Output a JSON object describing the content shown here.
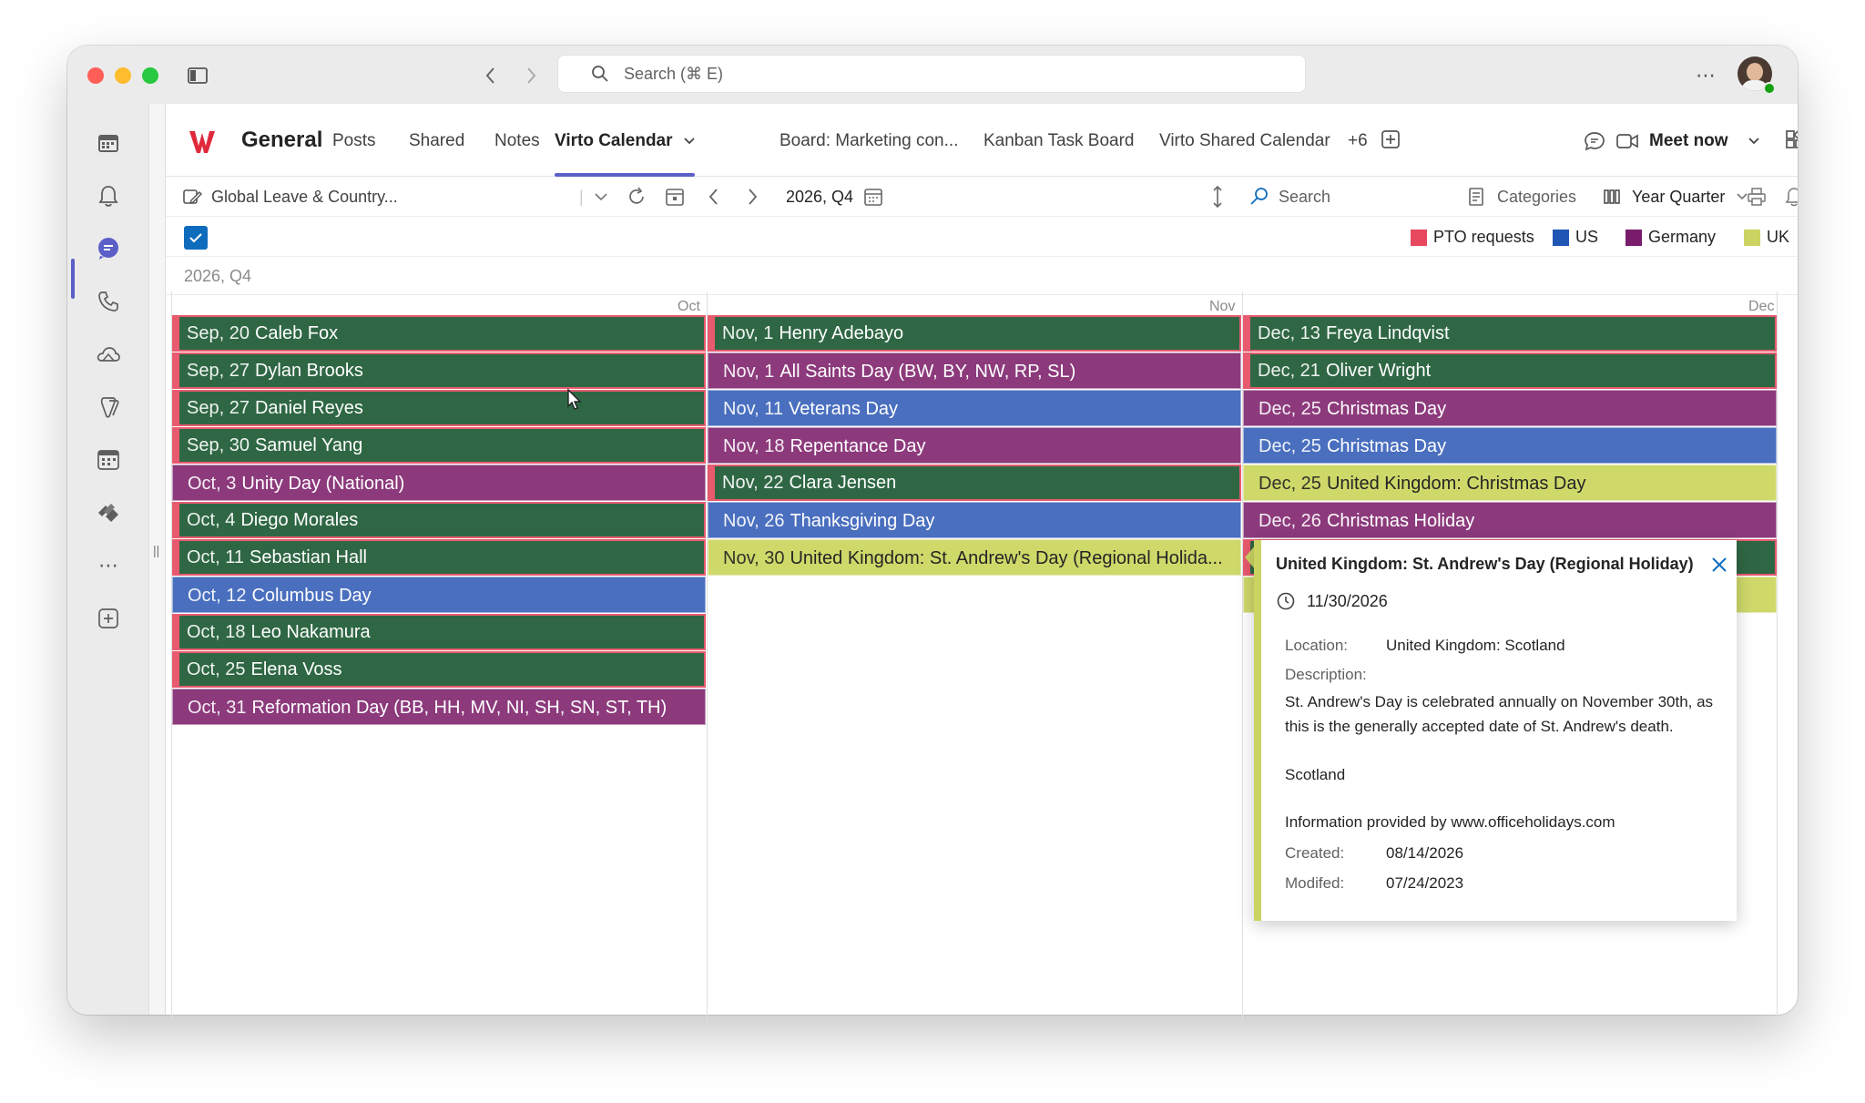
{
  "titlebar": {
    "search_placeholder": "Search (⌘ E)"
  },
  "channel": {
    "title": "General",
    "tabs": [
      {
        "label": "Posts"
      },
      {
        "label": "Shared"
      },
      {
        "label": "Notes"
      },
      {
        "label": "Virto Calendar"
      },
      {
        "label": "Board: Marketing con..."
      },
      {
        "label": "Kanban Task Board"
      },
      {
        "label": "Virto Shared Calendar"
      },
      {
        "label": "+6"
      }
    ],
    "meet_now": "Meet now"
  },
  "toolbar": {
    "calendar_name": "Global Leave & Country...",
    "period": "2026, Q4",
    "search_placeholder": "Search",
    "categories": "Categories",
    "view": "Year Quarter"
  },
  "legend": [
    {
      "label": "PTO requests",
      "color": "#e8485e"
    },
    {
      "label": "US",
      "color": "#1f55b5"
    },
    {
      "label": "Germany",
      "color": "#7a1c6c"
    },
    {
      "label": "UK",
      "color": "#cbd462"
    }
  ],
  "period_header": "2026, Q4",
  "months": [
    "Oct",
    "Nov",
    "Dec"
  ],
  "colors": {
    "pto": "#2f6744",
    "us": "#4a6fbf",
    "germany": "#8c3a7c",
    "uk": "#cfd96a",
    "pto_border": "#e85a6e",
    "accent": "#5b5fc7"
  },
  "columns": [
    {
      "events": [
        {
          "date": "Sep, 20",
          "title": "Caleb Fox",
          "type": "pto"
        },
        {
          "date": "Sep, 27",
          "title": "Dylan Brooks",
          "type": "pto"
        },
        {
          "date": "Sep, 27",
          "title": "Daniel Reyes",
          "type": "pto"
        },
        {
          "date": "Sep, 30",
          "title": "Samuel Yang",
          "type": "pto"
        },
        {
          "date": "Oct, 3",
          "title": "Unity Day (National)",
          "type": "germany"
        },
        {
          "date": "Oct, 4",
          "title": "Diego Morales",
          "type": "pto"
        },
        {
          "date": "Oct, 11",
          "title": "Sebastian Hall",
          "type": "pto"
        },
        {
          "date": "Oct, 12",
          "title": "Columbus Day",
          "type": "us"
        },
        {
          "date": "Oct, 18",
          "title": "Leo Nakamura",
          "type": "pto"
        },
        {
          "date": "Oct, 25",
          "title": "Elena Voss",
          "type": "pto"
        },
        {
          "date": "Oct, 31",
          "title": "Reformation Day (BB, HH, MV, NI, SH, SN, ST, TH)",
          "type": "germany"
        }
      ]
    },
    {
      "events": [
        {
          "date": "Nov, 1",
          "title": "Henry Adebayo",
          "type": "pto"
        },
        {
          "date": "Nov, 1",
          "title": "All Saints Day (BW, BY, NW, RP, SL)",
          "type": "germany"
        },
        {
          "date": "Nov, 11",
          "title": "Veterans Day",
          "type": "us"
        },
        {
          "date": "Nov, 18",
          "title": "Repentance Day",
          "type": "germany"
        },
        {
          "date": "Nov, 22",
          "title": "Clara Jensen",
          "type": "pto"
        },
        {
          "date": "Nov, 26",
          "title": "Thanksgiving Day",
          "type": "us"
        },
        {
          "date": "Nov, 30",
          "title": "United Kingdom: St. Andrew's Day (Regional Holida...",
          "type": "uk"
        }
      ]
    },
    {
      "events": [
        {
          "date": "Dec, 13",
          "title": "Freya Lindqvist",
          "type": "pto"
        },
        {
          "date": "Dec, 21",
          "title": "Oliver Wright",
          "type": "pto"
        },
        {
          "date": "Dec, 25",
          "title": "Christmas Day",
          "type": "germany"
        },
        {
          "date": "Dec, 25",
          "title": "Christmas Day",
          "type": "us"
        },
        {
          "date": "Dec, 25",
          "title": "United Kingdom: Christmas Day",
          "type": "uk"
        },
        {
          "date": "Dec, 26",
          "title": "Christmas Holiday",
          "type": "germany"
        },
        {
          "date": "",
          "title": "",
          "type": "pto"
        },
        {
          "date": "",
          "title": "",
          "type": "uk"
        }
      ]
    }
  ],
  "popup": {
    "title": "United Kingdom: St. Andrew's Day (Regional Holiday)",
    "date": "11/30/2026",
    "location_label": "Location:",
    "location": "United Kingdom: Scotland",
    "description_label": "Description:",
    "description": "St. Andrew's Day is celebrated annually on November 30th, as this is the generally accepted date of St. Andrew's death.",
    "region": "Scotland",
    "source": "Information provided by www.officeholidays.com",
    "created_label": "Created:",
    "created": "08/14/2026",
    "modified_label": "Modifed:",
    "modified": "07/24/2023"
  }
}
